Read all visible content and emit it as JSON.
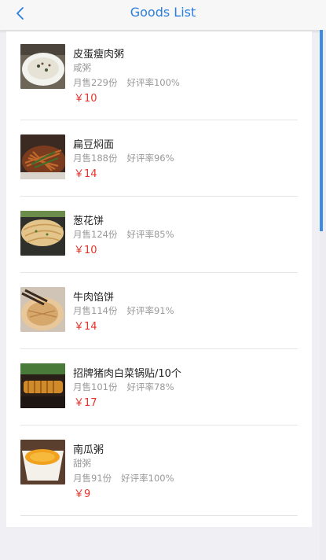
{
  "header": {
    "title": "Goods List",
    "back_icon": "chevron-left-icon"
  },
  "items": [
    {
      "name": "皮蛋瘦肉粥",
      "desc": "咸粥",
      "sales": "月售229份",
      "rating": "好评率100%",
      "price": "￥10"
    },
    {
      "name": "扁豆焖面",
      "desc": "",
      "sales": "月售188份",
      "rating": "好评率96%",
      "price": "￥14"
    },
    {
      "name": "葱花饼",
      "desc": "",
      "sales": "月售124份",
      "rating": "好评率85%",
      "price": "￥10"
    },
    {
      "name": "牛肉馅饼",
      "desc": "",
      "sales": "月售114份",
      "rating": "好评率91%",
      "price": "￥14"
    },
    {
      "name": "招牌猪肉白菜锅贴/10个",
      "desc": "",
      "sales": "月售101份",
      "rating": "好评率78%",
      "price": "￥17"
    },
    {
      "name": "南瓜粥",
      "desc": "甜粥",
      "sales": "月售91份",
      "rating": "好评率100%",
      "price": "￥9"
    }
  ],
  "colors": {
    "accent": "#2a7de1",
    "price": "#e5332a",
    "muted": "#999999"
  }
}
